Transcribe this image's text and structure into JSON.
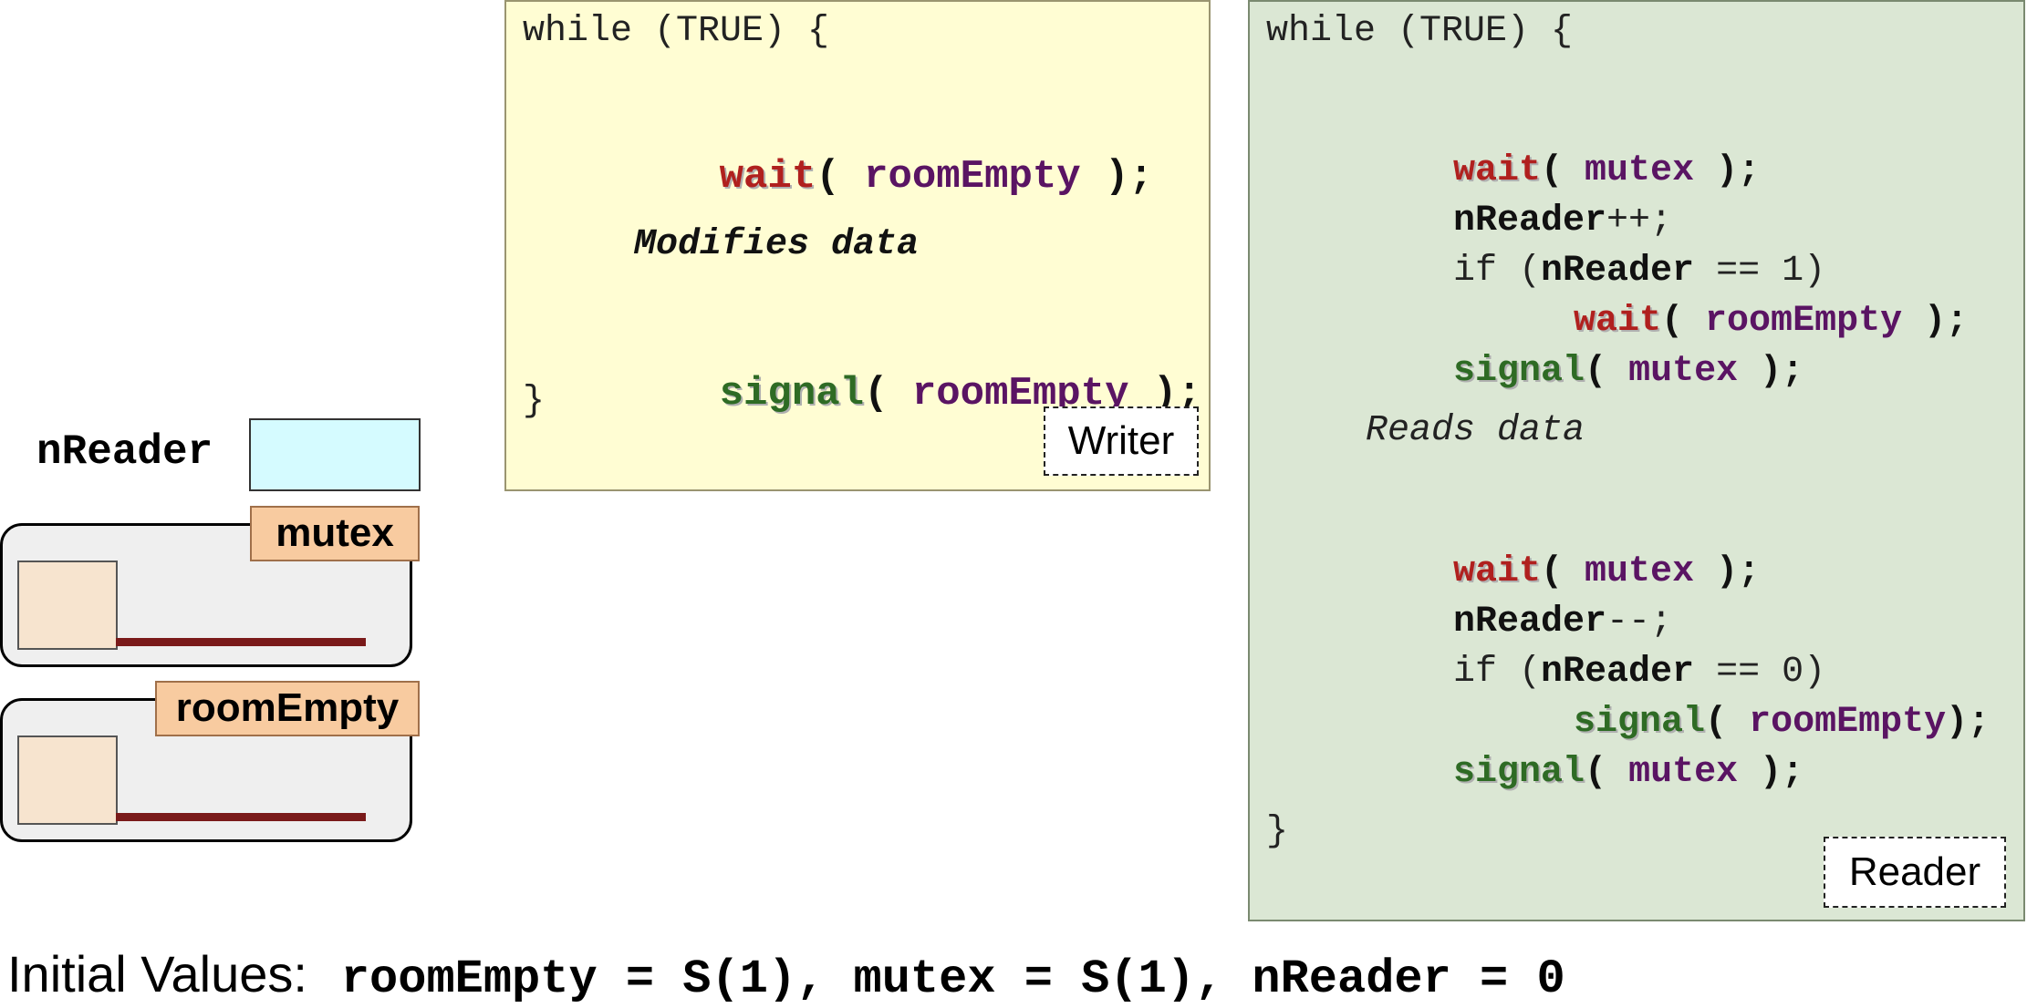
{
  "state": {
    "nreader_label": "nReader",
    "mutex_label": "mutex",
    "roomempty_label": "roomEmpty"
  },
  "writer": {
    "while": "while (TRUE) {",
    "wait_kw": "wait",
    "open_paren": "( ",
    "room_empty": "roomEmpty",
    "close_paren": " );",
    "modifies": "Modifies data",
    "signal_kw": "signal",
    "closing_brace": "}",
    "label": "Writer"
  },
  "reader": {
    "while": "while (TRUE) {",
    "wait_kw": "wait",
    "signal_kw": "signal",
    "open_paren": "( ",
    "open_paren_no_space": "( ",
    "mutex": "mutex",
    "room_empty": "roomEmpty",
    "close_paren": " );",
    "close_paren_tight": ");",
    "nreader": "nReader",
    "inc": "++;",
    "dec": "--;",
    "if_prefix": "if (",
    "eq1": " == 1)",
    "eq0": " == 0)",
    "reads": "Reads data",
    "closing_brace": "}",
    "label": "Reader"
  },
  "footer": {
    "label": "Initial Values:",
    "values": "roomEmpty = S(1), mutex = S(1), nReader = 0"
  }
}
